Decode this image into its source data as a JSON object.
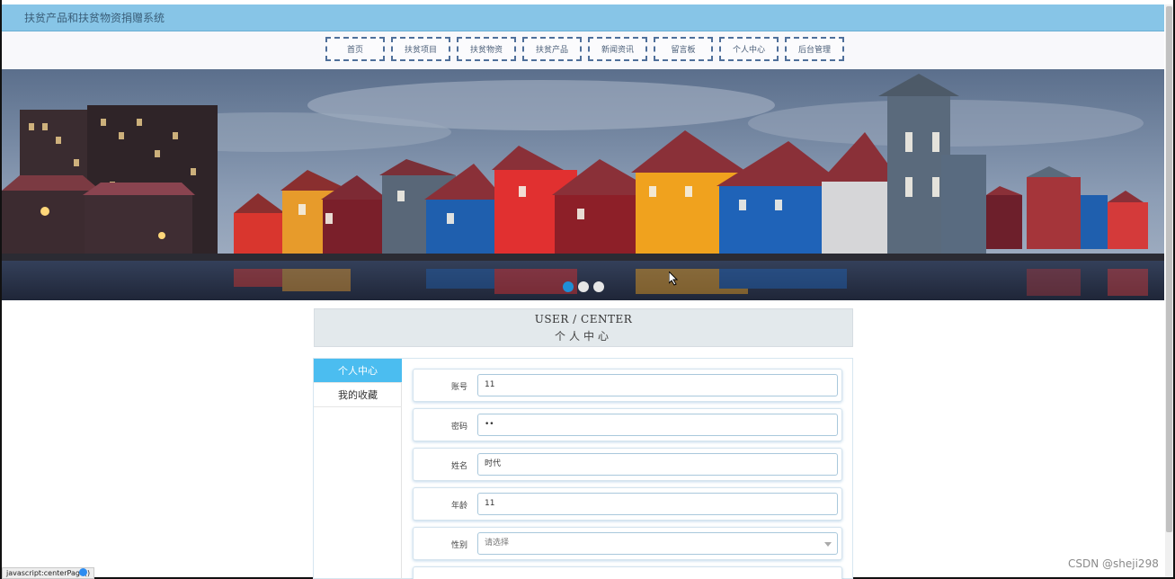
{
  "app": {
    "title": "扶贫产品和扶贫物资捐赠系统"
  },
  "nav": {
    "items": [
      {
        "label": "首页"
      },
      {
        "label": "扶贫项目"
      },
      {
        "label": "扶贫物资"
      },
      {
        "label": "扶贫产品"
      },
      {
        "label": "新闻资讯"
      },
      {
        "label": "留言板"
      },
      {
        "label": "个人中心"
      },
      {
        "label": "后台管理"
      }
    ]
  },
  "carousel": {
    "slide_count": 3,
    "active_slide": 1
  },
  "section": {
    "title_en": "USER / CENTER",
    "title_zh": "个人中心"
  },
  "sidebar": {
    "items": [
      {
        "label": "个人中心",
        "active": true
      },
      {
        "label": "我的收藏",
        "active": false
      }
    ]
  },
  "form": {
    "account_label": "账号",
    "account_value": "11",
    "password_label": "密码",
    "password_value": "••",
    "name_label": "姓名",
    "name_value": "时代",
    "age_label": "年龄",
    "age_value": "11",
    "gender_label": "性别",
    "gender_placeholder": "请选择"
  },
  "status_bar": {
    "url": "javascript:centerPage()"
  },
  "watermark": {
    "text": "CSDN @sheji298"
  },
  "colors": {
    "header_bg": "#87c5e7",
    "accent": "#4bbdf0",
    "nav_border": "#4f6f9a"
  }
}
